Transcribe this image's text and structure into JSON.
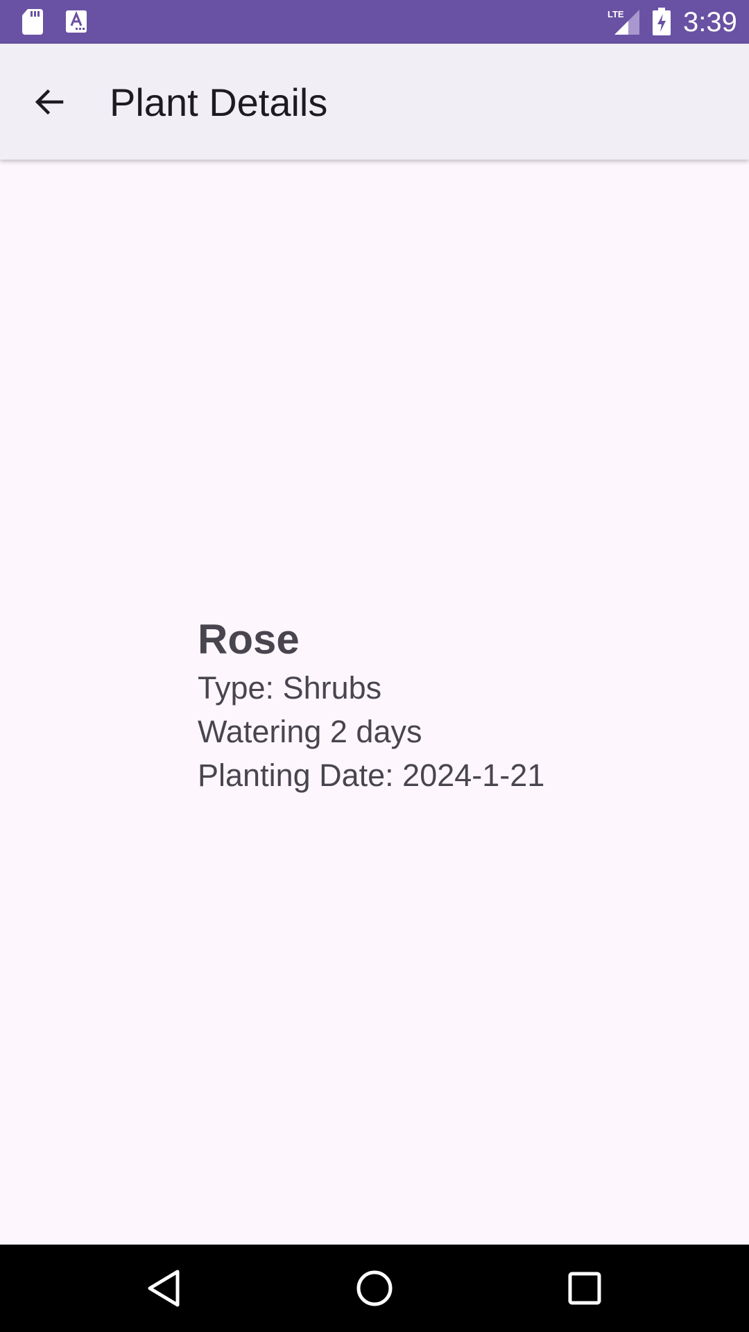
{
  "status_bar": {
    "time": "3:39",
    "background_color": "#6951a3",
    "icons": [
      "sd-card-icon",
      "text-a-icon",
      "lte-signal-icon",
      "battery-charging-icon"
    ]
  },
  "app_bar": {
    "title": "Plant Details",
    "back_icon": "arrow-back-icon",
    "background_color": "#f2eef6"
  },
  "plant": {
    "name": "Rose",
    "type": "Type: Shrubs",
    "watering": "Watering 2 days",
    "planting_date": "Planting Date: 2024-1-21"
  },
  "nav_bar": {
    "buttons": [
      "back-triangle-icon",
      "home-circle-icon",
      "recents-square-icon"
    ]
  },
  "colors": {
    "page_background": "#fdf7fd",
    "text_primary": "#1d1b20",
    "text_secondary": "#49454f"
  }
}
